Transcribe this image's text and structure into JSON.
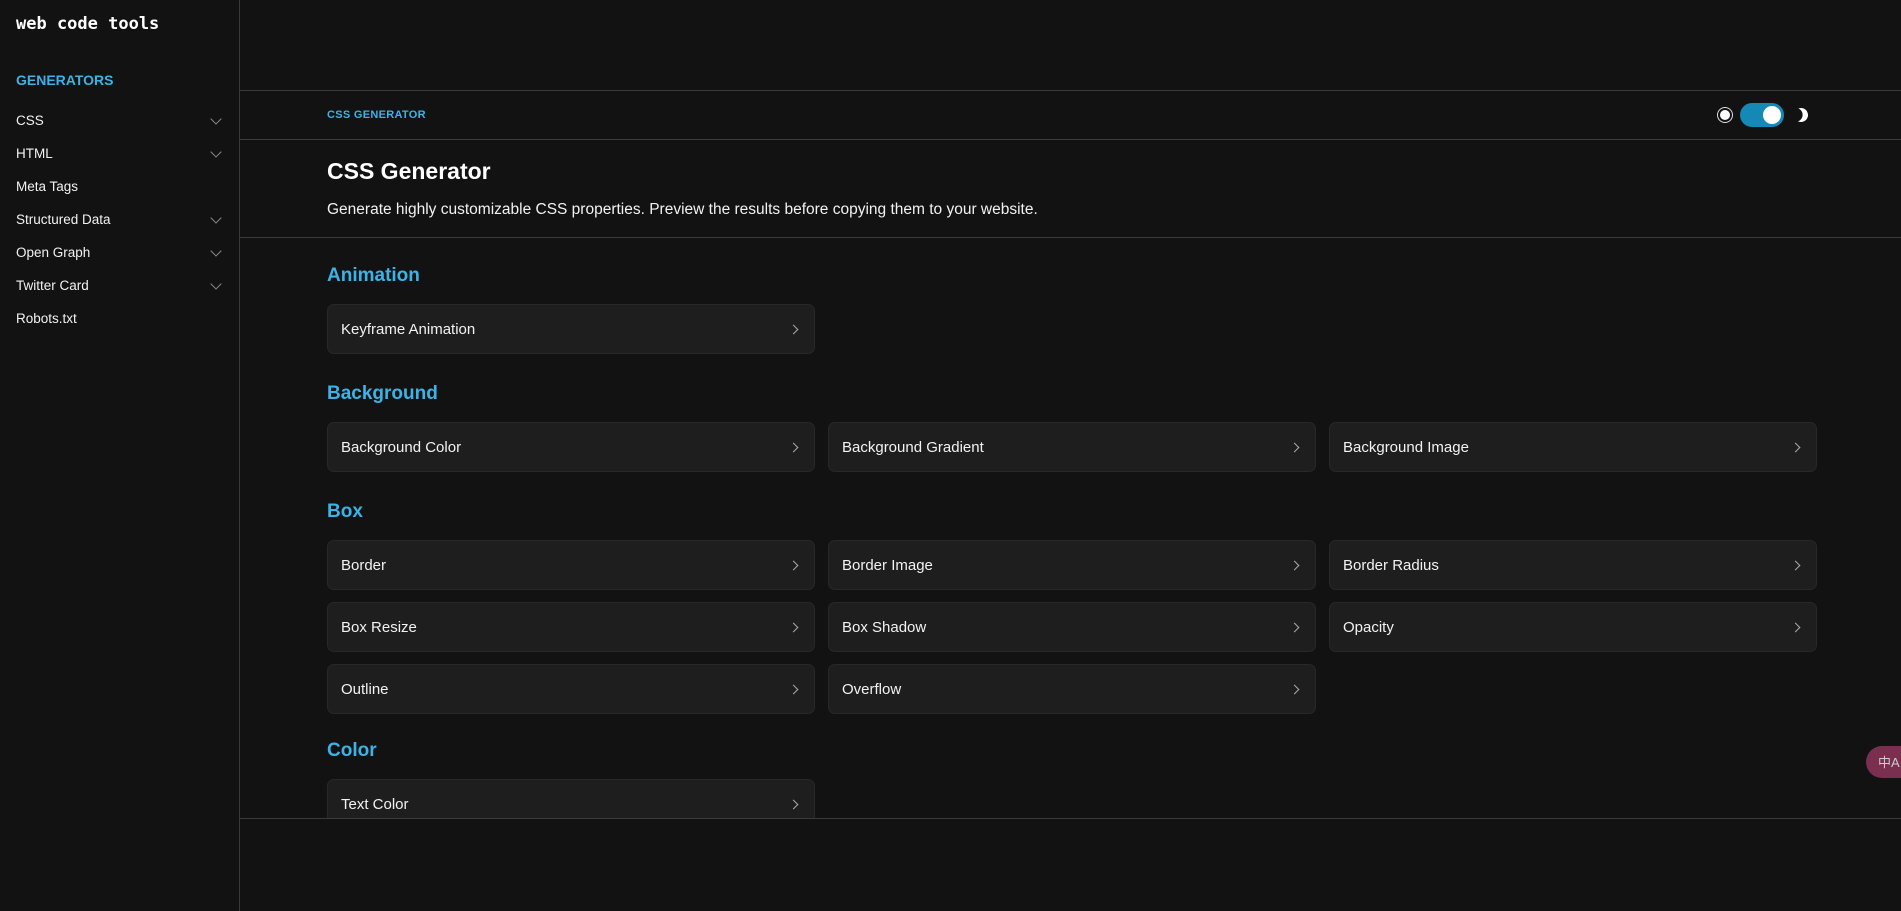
{
  "sidebar": {
    "logo": "web code tools",
    "section": "GENERATORS",
    "items": [
      {
        "label": "CSS",
        "expandable": true
      },
      {
        "label": "HTML",
        "expandable": true
      },
      {
        "label": "Meta Tags",
        "expandable": false
      },
      {
        "label": "Structured Data",
        "expandable": true
      },
      {
        "label": "Open Graph",
        "expandable": true
      },
      {
        "label": "Twitter Card",
        "expandable": true
      },
      {
        "label": "Robots.txt",
        "expandable": false
      }
    ]
  },
  "header": {
    "breadcrumb": "CSS GENERATOR",
    "theme": "dark",
    "accent": "#3bb3e6",
    "toggle_color": "#1589b5"
  },
  "page": {
    "title": "CSS Generator",
    "description": "Generate highly customizable CSS properties. Preview the results before copying them to your website."
  },
  "groups": [
    {
      "title": "Animation",
      "items": [
        "Keyframe Animation"
      ]
    },
    {
      "title": "Background",
      "items": [
        "Background Color",
        "Background Gradient",
        "Background Image"
      ]
    },
    {
      "title": "Box",
      "items": [
        "Border",
        "Border Image",
        "Border Radius",
        "Box Resize",
        "Box Shadow",
        "Opacity",
        "Outline",
        "Overflow"
      ]
    },
    {
      "title": "Color",
      "items": [
        "Text Color"
      ]
    }
  ],
  "translate_widget": {
    "icon": "translate-icon",
    "label": "中A"
  }
}
